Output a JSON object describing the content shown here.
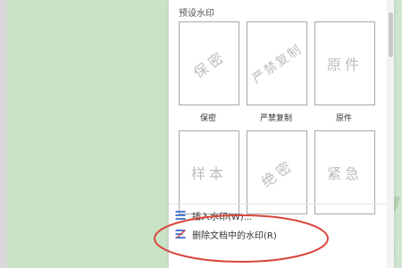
{
  "panel": {
    "section_title": "预设水印",
    "presets": [
      {
        "watermark": "保密",
        "label": "保密"
      },
      {
        "watermark": "严禁复制",
        "label": "严禁复制"
      },
      {
        "watermark": "原件",
        "label": "原件"
      },
      {
        "watermark": "样本",
        "label": ""
      },
      {
        "watermark": "绝密",
        "label": ""
      },
      {
        "watermark": "紧急",
        "label": ""
      }
    ],
    "menu": {
      "insert_label": "插入水印(W)...",
      "insert_icon": "insert-watermark-icon",
      "delete_label": "删除文档中的水印(R)",
      "delete_icon": "delete-watermark-icon"
    }
  },
  "colors": {
    "document_background": "#cfe5cf",
    "highlight_ellipse": "#d9453c",
    "watermark_text": "#bdbdbd"
  }
}
